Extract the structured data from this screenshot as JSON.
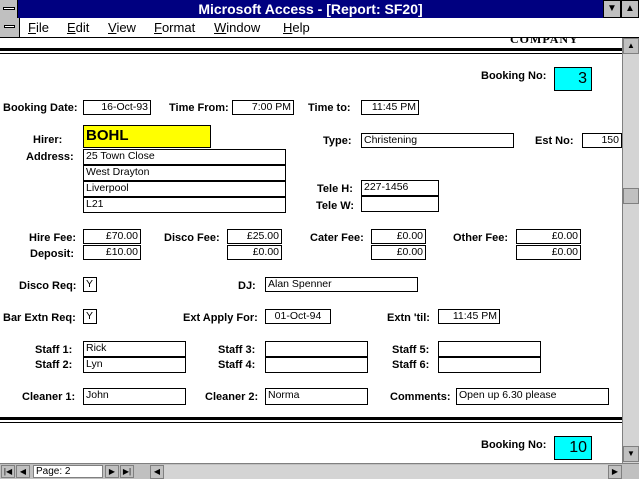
{
  "window": {
    "title": "Microsoft Access - [Report: SF20]"
  },
  "menu": [
    "File",
    "Edit",
    "View",
    "Format",
    "Window",
    "Help"
  ],
  "report": {
    "header_fragment": "COMPANY",
    "booking_no_label": "Booking No:",
    "booking_no": "3",
    "labels": {
      "booking_date": "Booking Date:",
      "time_from": "Time From:",
      "time_to": "Time to:",
      "hirer": "Hirer:",
      "address": "Address:",
      "type": "Type:",
      "est_no": "Est No:",
      "tele_h": "Tele H:",
      "tele_w": "Tele W:",
      "hire_fee": "Hire Fee:",
      "deposit": "Deposit:",
      "disco_fee": "Disco Fee:",
      "cater_fee": "Cater Fee:",
      "other_fee": "Other Fee:",
      "disco_req": "Disco Req:",
      "dj": "DJ:",
      "bar_extn_req": "Bar Extn Req:",
      "ext_apply_for": "Ext Apply For:",
      "extn_til": "Extn 'til:",
      "staff1": "Staff 1:",
      "staff2": "Staff 2:",
      "staff3": "Staff 3:",
      "staff4": "Staff 4:",
      "staff5": "Staff 5:",
      "staff6": "Staff 6:",
      "cleaner1": "Cleaner 1:",
      "cleaner2": "Cleaner 2:",
      "comments": "Comments:"
    },
    "values": {
      "booking_date": "16-Oct-93",
      "time_from": "7:00 PM",
      "time_to": "11:45 PM",
      "hirer": "BOHL",
      "address1": "25 Town Close",
      "address2": "West Drayton",
      "address3": "Liverpool",
      "address4": "L21",
      "type": "Christening",
      "est_no": "150",
      "tele_h": "227-1456",
      "tele_w": "",
      "hire_fee": "£70.00",
      "deposit": "£10.00",
      "disco_fee": "£25.00",
      "disco_fee2": "£0.00",
      "cater_fee": "£0.00",
      "cater_fee2": "£0.00",
      "other_fee": "£0.00",
      "other_fee2": "£0.00",
      "disco_req": "Y",
      "dj": "Alan Spenner",
      "bar_extn_req": "Y",
      "ext_apply_for": "01-Oct-94",
      "extn_til": "11:45 PM",
      "staff1": "Rick",
      "staff2": "Lyn",
      "staff3": "",
      "staff4": "",
      "staff5": "",
      "staff6": "",
      "cleaner1": "John",
      "cleaner2": "Norma",
      "comments": "Open up 6.30 please"
    },
    "next_booking_no_label": "Booking No:",
    "next_booking_no": "10"
  },
  "status": {
    "page_label": "Page:",
    "page_value": "2"
  }
}
